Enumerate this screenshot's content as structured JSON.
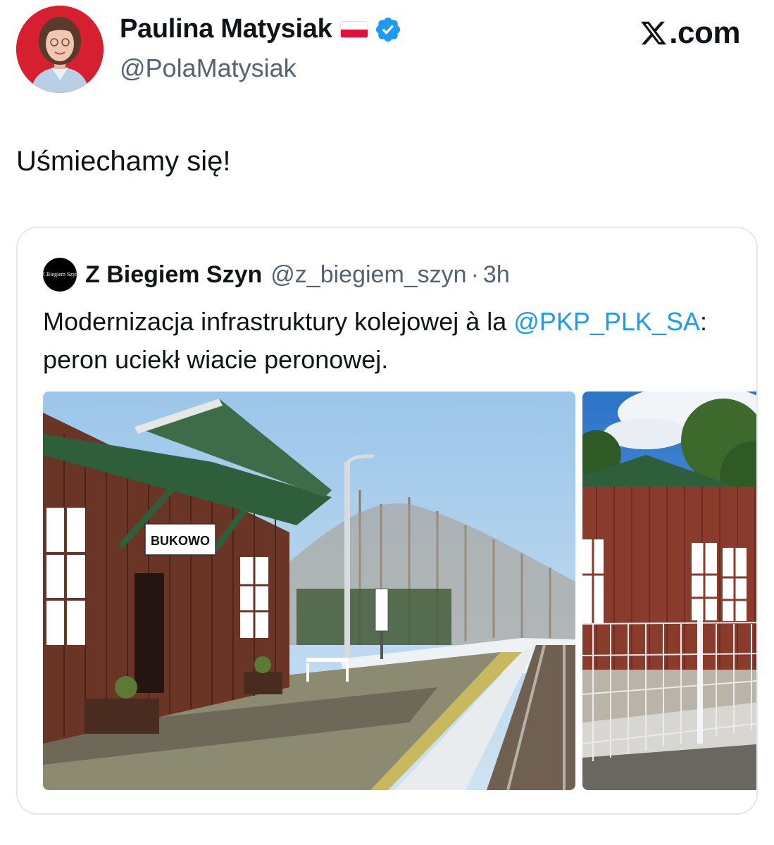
{
  "site": {
    "label": ".com"
  },
  "author": {
    "display_name": "Paulina Matysiak",
    "handle": "@PolaMatysiak"
  },
  "tweet": {
    "text": "Uśmiechamy się!"
  },
  "quoted": {
    "avatar_text": "Z Biegiem Szyn",
    "name": "Z Biegiem Szyn",
    "handle": "@z_biegiem_szyn",
    "separator": "·",
    "time": "3h",
    "text_before": "Modernizacja infrastruktury kolejowej à la ",
    "mention": "@PKP_PLK_SA",
    "text_after": ": peron uciekł wiacie peronowej.",
    "photo1_sign": "BUKOWO"
  },
  "colors": {
    "accent": "#1d9bf0",
    "verified": "#1d9bf0",
    "secondary_text": "#536471"
  }
}
